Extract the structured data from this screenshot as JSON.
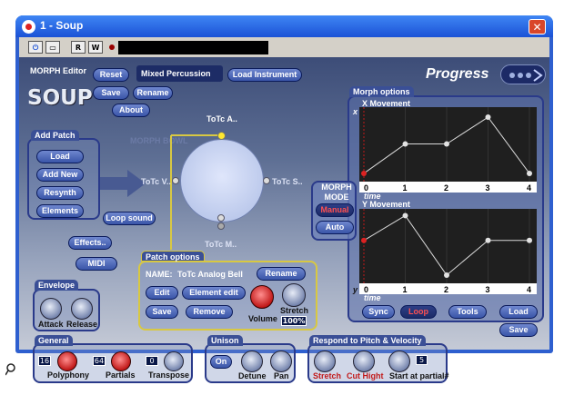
{
  "window": {
    "title": "1 - Soup",
    "close_glyph": "✕"
  },
  "toolbar": {
    "power": "⏻",
    "monitor": "▭",
    "read": "R",
    "write": "W"
  },
  "header": {
    "editor_label": "MORPH Editor",
    "reset": "Reset",
    "patch_name": "Mixed Percussion",
    "load_instrument": "Load Instrument",
    "save": "Save",
    "rename": "Rename",
    "about": "About",
    "logo": "SOUP",
    "brand": "Progress"
  },
  "add_patch": {
    "title": "Add Patch",
    "load": "Load",
    "add_new": "Add New",
    "resynth": "Resynth",
    "elements": "Elements"
  },
  "morph_bowl": {
    "label": "MORPH BOWL",
    "top": "ToTc A..",
    "left": "ToTc V..",
    "right": "ToTc S..",
    "bottom": "ToTc M..",
    "loop_sound": "Loop sound"
  },
  "buttons": {
    "effects": "Effects..",
    "midi": "MIDI"
  },
  "patch_options": {
    "title": "Patch options",
    "name_label": "NAME:",
    "name_value": "ToTc Analog Bell",
    "rename": "Rename",
    "edit": "Edit",
    "element_edit": "Element edit",
    "save": "Save",
    "remove": "Remove",
    "volume": "Volume",
    "stretch": "Stretch",
    "stretch_value": "100%"
  },
  "envelope": {
    "title": "Envelope",
    "attack": "Attack",
    "release": "Release"
  },
  "general": {
    "title": "General",
    "polyphony_value": "16",
    "polyphony": "Polyphony",
    "partials_value": "64",
    "partials": "Partials",
    "transpose_value": "0",
    "transpose": "Transpose"
  },
  "unison": {
    "title": "Unison",
    "on": "On",
    "detune": "Detune",
    "pan": "Pan"
  },
  "respond": {
    "title": "Respond to Pitch & Velocity",
    "stretch": "Stretch",
    "cut_hight": "Cut Hight",
    "start_value": "5",
    "start_at_partial": "Start at partial#"
  },
  "morph_options": {
    "title": "Morph options",
    "x_title": "X Movement",
    "y_title": "Y Movement",
    "x_axis_letter": "x",
    "y_axis_letter": "y",
    "time_label": "time",
    "ticks": [
      "0",
      "1",
      "2",
      "3",
      "4"
    ],
    "morph_mode_title": "MORPH MODE",
    "manual": "Manual",
    "auto": "Auto",
    "sync": "Sync",
    "loop": "Loop",
    "tools": "Tools",
    "load": "Load",
    "save": "Save"
  },
  "chart_data": [
    {
      "type": "line",
      "title": "X Movement",
      "x": [
        0,
        1,
        2,
        3,
        4
      ],
      "y": [
        0.07,
        0.52,
        0.52,
        0.93,
        0.07
      ],
      "xlim": [
        0,
        4
      ],
      "ylim": [
        0,
        1
      ],
      "xlabel": "time",
      "ylabel": "x"
    },
    {
      "type": "line",
      "title": "Y Movement",
      "x": [
        0,
        1,
        2,
        3,
        4
      ],
      "y": [
        0.6,
        0.98,
        0.07,
        0.6,
        0.6
      ],
      "xlim": [
        0,
        4
      ],
      "ylim": [
        0,
        1
      ],
      "xlabel": "time",
      "ylabel": "y"
    }
  ],
  "colors": {
    "accent_red": "#c21a1a",
    "panel_border": "#2a3a8a",
    "title_blue": "#1b52d6"
  }
}
